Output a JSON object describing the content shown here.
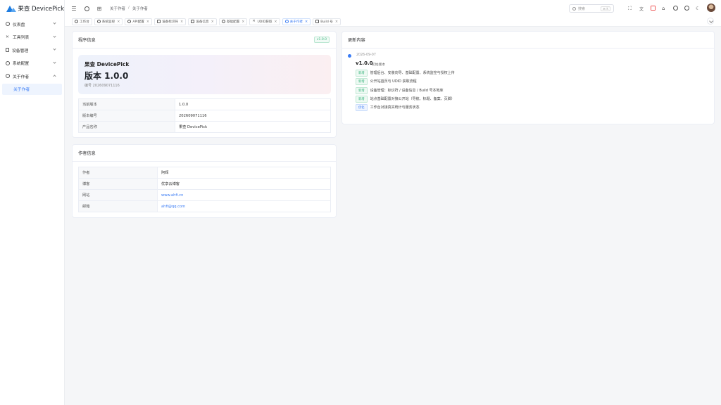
{
  "app": {
    "title": "果查 DevicePick"
  },
  "sidebar": {
    "items": [
      {
        "label": "仪表盘",
        "icon": "dashboard-icon"
      },
      {
        "label": "工具列表",
        "icon": "tools-icon"
      },
      {
        "label": "设备管理",
        "icon": "device-icon"
      },
      {
        "label": "系统配置",
        "icon": "gear-icon"
      },
      {
        "label": "关于作者",
        "icon": "user-icon"
      }
    ],
    "active_sub": "关于作者"
  },
  "header": {
    "breadcrumb": [
      "关于作者",
      "关于作者"
    ],
    "search_placeholder": "搜索",
    "search_shortcut": "⌘ K"
  },
  "tabs": [
    {
      "label": "工作台",
      "closable": false
    },
    {
      "label": "系统监控",
      "closable": true
    },
    {
      "label": "API配置",
      "closable": true
    },
    {
      "label": "设备标识符",
      "closable": true
    },
    {
      "label": "设备信息",
      "closable": true
    },
    {
      "label": "基础配置",
      "closable": true
    },
    {
      "label": "UDID获取",
      "closable": true
    },
    {
      "label": "关于作者",
      "closable": true,
      "active": true
    },
    {
      "label": "Build 号",
      "closable": true
    }
  ],
  "program": {
    "title": "程序信息",
    "badge": "v1.0.0",
    "name": "果查 DevicePick",
    "version_title": "版本 1.0.0",
    "build_line": "编号 202609071116",
    "rows": [
      {
        "k": "当前版本",
        "v": "1.0.0"
      },
      {
        "k": "版本编号",
        "v": "202609071116"
      },
      {
        "k": "产品名称",
        "v": "果查 DevicePick"
      }
    ]
  },
  "author": {
    "title": "作者信息",
    "rows": [
      {
        "k": "作者",
        "v": "阿辉"
      },
      {
        "k": "博客",
        "v": "优享云博客"
      },
      {
        "k": "网站",
        "v": "www.ahfi.cn",
        "link": true
      },
      {
        "k": "邮箱",
        "v": "ahfi@qq.com",
        "link": true
      }
    ]
  },
  "changelog": {
    "title": "更新内容",
    "date": "2026-09-07",
    "version": "v1.0.0",
    "subtitle": "初始版本",
    "items": [
      {
        "tag": "新增",
        "kind": "new",
        "text": "管理后台、安装向导、基础配置、系统监控与授权上传"
      },
      {
        "tag": "新增",
        "kind": "new",
        "text": "公开站首页与 UDID 获取流程"
      },
      {
        "tag": "新增",
        "kind": "new",
        "text": "设备管理：标识符 / 设备信息 / Build 号本地库"
      },
      {
        "tag": "新增",
        "kind": "new",
        "text": "站点基础配置对接公开站（导航、标题、备案、页脚）"
      },
      {
        "tag": "优化",
        "kind": "opt",
        "text": "工作台对接真实统计与服务状态"
      }
    ]
  }
}
